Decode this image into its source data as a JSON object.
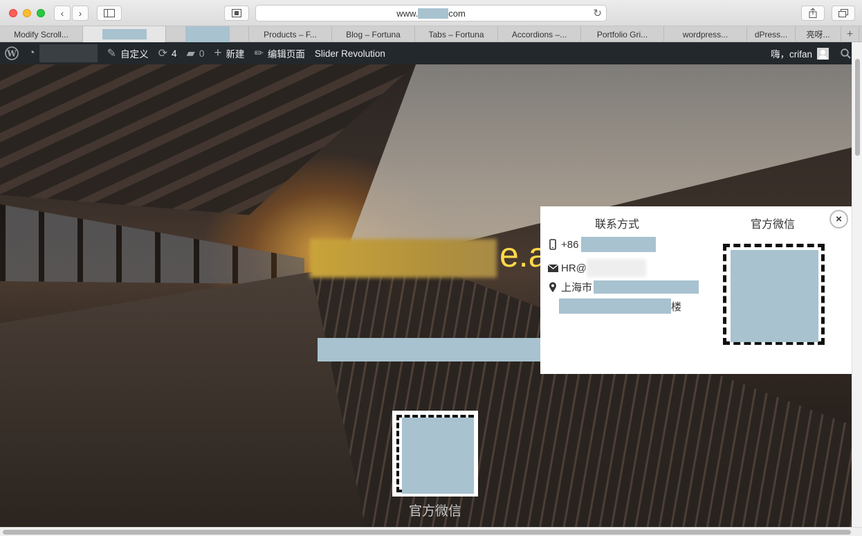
{
  "browser": {
    "url_prefix": "www.",
    "url_suffix": "com",
    "tabs": [
      {
        "label": "Modify Scroll...",
        "active": false
      },
      {
        "label": "",
        "active": true
      },
      {
        "label": "",
        "active": false
      },
      {
        "label": "Products – F...",
        "active": false
      },
      {
        "label": "Blog – Fortuna",
        "active": false
      },
      {
        "label": "Tabs – Fortuna",
        "active": false
      },
      {
        "label": "Accordions –...",
        "active": false
      },
      {
        "label": "Portfolio Gri...",
        "active": false
      },
      {
        "label": "wordpress...",
        "active": false
      },
      {
        "label": "dPress...",
        "active": false
      },
      {
        "label": "亮呀...",
        "active": false
      }
    ],
    "new_tab_label": "+"
  },
  "admin_bar": {
    "customize_label": "自定义",
    "updates_count": "4",
    "comments_count": "0",
    "new_label": "新建",
    "edit_page_label": "编辑页面",
    "slider_label": "Slider Revolution",
    "greeting": "嗨，crifan"
  },
  "hero": {
    "title_visible_fragment": "e.ai",
    "qr_caption": "官方微信"
  },
  "popup": {
    "contact_heading": "联系方式",
    "wechat_heading": "官方微信",
    "close_label": "×",
    "phone_prefix": "+86",
    "email_prefix": "HR@",
    "address_prefix": "上海市",
    "address_suffix": "楼"
  },
  "colors": {
    "admin_bar_bg": "#23282d",
    "redaction": "#a8c2cf",
    "hero_title": "#ffd84a"
  }
}
